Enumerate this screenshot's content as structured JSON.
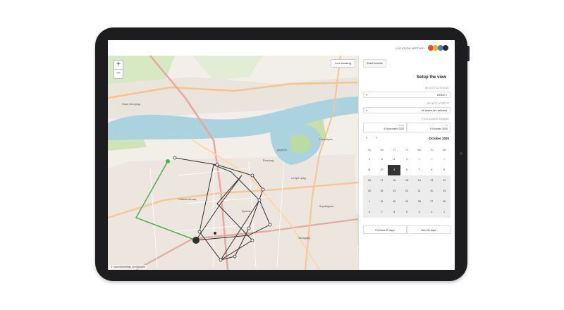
{
  "app": {
    "brand_text": "LOCATION HISTORY",
    "logo_colors": [
      "#e8473f",
      "#f2b400",
      "#3b7ddd",
      "#2a2a2a"
    ]
  },
  "map": {
    "zoom_in": "+",
    "zoom_out": "−",
    "tool_label": "Line tracking",
    "attribution": "© OpenStreetMap contributors",
    "place_labels": [
      "Београд",
      "Савски венац",
      "Врачар",
      "Стари град",
      "Звездара",
      "Нови Београд",
      "Палилула",
      "Дорћол",
      "Карабурма"
    ],
    "route_colors": {
      "dark": "#2f2f2f",
      "green": "#4caf50"
    }
  },
  "panel": {
    "title": "Setup the view",
    "reset_button": "Reset timeline",
    "select_device_label": "SELECT A DEVICE",
    "select_device_value": "Device 1",
    "select_assets_label": "SELECT ASSETS",
    "select_assets_value": "All assets are selected",
    "date_range_label": "PICK A DATE RANGE",
    "date_from_sub": "To",
    "date_from": "9 October 2020",
    "date_to_sub": "From",
    "date_to": "9 November 2020",
    "calendar": {
      "month": "October 2020",
      "prev": "‹",
      "next": "›",
      "weekdays": [
        "Su",
        "Sa",
        "Fr",
        "Th",
        "We",
        "Tu",
        "Mo"
      ],
      "rows": [
        [
          "4",
          "3",
          "2",
          "1",
          "30",
          "29",
          "28"
        ],
        [
          "11",
          "10",
          "9",
          "8",
          "7",
          "6",
          "5"
        ],
        [
          "18",
          "17",
          "16",
          "15",
          "14",
          "13",
          "12"
        ],
        [
          "25",
          "24",
          "23",
          "22",
          "21",
          "20",
          "19"
        ],
        [
          "1",
          "31",
          "30",
          "29",
          "28",
          "27",
          "26"
        ],
        [
          "8",
          "7",
          "6",
          "5",
          "4",
          "3",
          "2"
        ]
      ]
    },
    "prev_days_button": "Previous 30 days",
    "next_days_button": "Next 30 days"
  }
}
